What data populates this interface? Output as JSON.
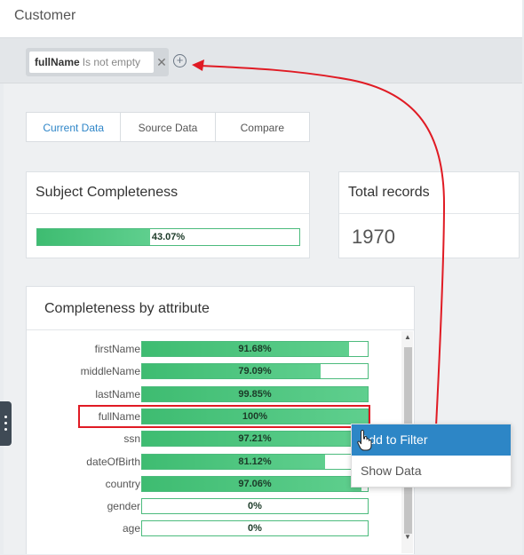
{
  "page": {
    "title": "Customer"
  },
  "filter": {
    "field": "fullName",
    "operator": "Is not empty"
  },
  "tabs": [
    {
      "label": "Current Data",
      "active": true
    },
    {
      "label": "Source Data",
      "active": false
    },
    {
      "label": "Compare",
      "active": false
    }
  ],
  "subject": {
    "title": "Subject Completeness",
    "value": 43.07,
    "label": "43.07%"
  },
  "total": {
    "title": "Total records",
    "count": "1970"
  },
  "attributes": {
    "title": "Completeness by attribute",
    "rows": [
      {
        "name": "firstName",
        "value": 91.68,
        "label": "91.68%"
      },
      {
        "name": "middleName",
        "value": 79.09,
        "label": "79.09%"
      },
      {
        "name": "lastName",
        "value": 99.85,
        "label": "99.85%"
      },
      {
        "name": "fullName",
        "value": 100,
        "label": "100%"
      },
      {
        "name": "ssn",
        "value": 97.21,
        "label": "97.21%"
      },
      {
        "name": "dateOfBirth",
        "value": 81.12,
        "label": "81.12%"
      },
      {
        "name": "country",
        "value": 97.06,
        "label": "97.06%"
      },
      {
        "name": "gender",
        "value": 0,
        "label": "0%"
      },
      {
        "name": "age",
        "value": 0,
        "label": "0%"
      }
    ]
  },
  "context_menu": {
    "items": [
      "Add to Filter",
      "Show Data"
    ],
    "selected": "Add to Filter"
  },
  "colors": {
    "bar_fill": "#3ebc71",
    "accent": "#2f86c8",
    "annotation": "#e01b24"
  },
  "icons": [
    "close-icon",
    "plus-circle-icon",
    "hand-cursor-icon",
    "drag-handle-icon"
  ]
}
